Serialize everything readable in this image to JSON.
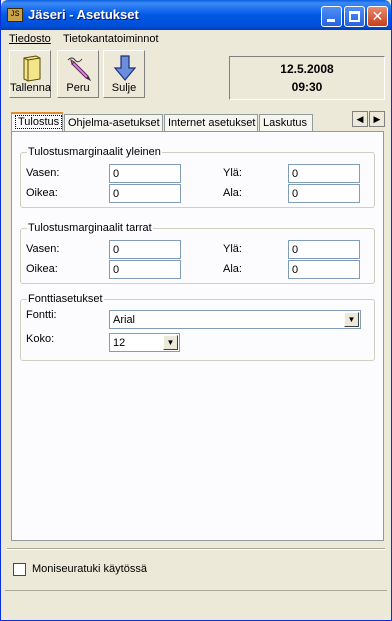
{
  "window": {
    "title": "Jäseri - Asetukset"
  },
  "menu": [
    {
      "label": "Tiedosto",
      "underline": "T"
    },
    {
      "label": "Tietokantatoiminnot"
    }
  ],
  "toolbar": {
    "save": "Tallenna",
    "cancel": "Peru",
    "close": "Sulje"
  },
  "datetime": {
    "date": "12.5.2008",
    "time": "09:30"
  },
  "tabs": [
    "Tulostus",
    "Ohjelma-asetukset",
    "Internet asetukset",
    "Laskutus"
  ],
  "print": {
    "general": {
      "legend": "Tulostusmarginaalit yleinen",
      "left_label": "Vasen:",
      "left": "0",
      "top_label": "Ylä:",
      "top": "0",
      "right_label": "Oikea:",
      "right": "0",
      "bottom_label": "Ala:",
      "bottom": "0"
    },
    "labels": {
      "legend": "Tulostusmarginaalit tarrat",
      "left_label": "Vasen:",
      "left": "0",
      "top_label": "Ylä:",
      "top": "0",
      "right_label": "Oikea:",
      "right": "0",
      "bottom_label": "Ala:",
      "bottom": "0"
    },
    "font": {
      "legend": "Fonttiasetukset",
      "font_label": "Fontti:",
      "font": "Arial",
      "size_label": "Koko:",
      "size": "12"
    }
  },
  "multi_club": {
    "label": "Moniseuratuki käytössä",
    "checked": false
  },
  "colors": {
    "title_bar": "#0058e6",
    "active_tab_accent": "#e68b2c",
    "face": "#ece9d8"
  },
  "icons": [
    "app-icon",
    "book-icon",
    "pencil-icon",
    "down-arrow-icon",
    "chevron-left-icon",
    "chevron-right-icon"
  ]
}
